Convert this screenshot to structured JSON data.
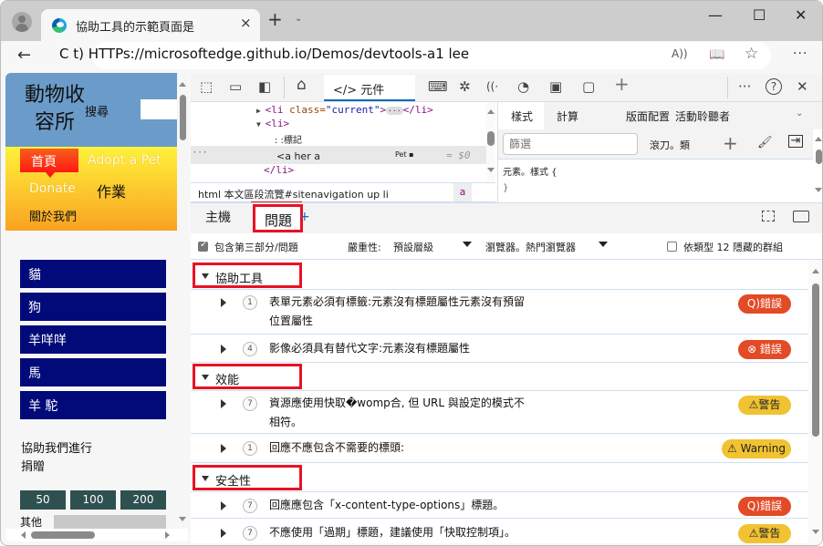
{
  "browser": {
    "tab_title": "協助工具的示範頁面是",
    "tab_close": "×",
    "new_tab": "+",
    "tab_menu": "⌄",
    "window_controls": {
      "minimize": "—",
      "maximize": "☐",
      "close": "✕"
    },
    "back": "←",
    "url": "C t) HTTPs://microsoftedge.github.io/Demos/devtools-a1 lee",
    "read_aloud_icon": "A))",
    "immersive_reader_icon": "📖",
    "favorite_icon": "☆",
    "more": "···"
  },
  "page": {
    "logo": "動物收容所",
    "search_label": "搜尋",
    "nav": {
      "home": "首頁",
      "adopt": "Adopt a Pet",
      "donate": "Donate",
      "jobs": "作業",
      "about": "關於我們"
    },
    "animals": [
      "貓",
      "狗",
      "羊咩咩",
      "馬",
      "羊 駝"
    ],
    "help_text": "協助我們進行捐贈",
    "amounts": [
      "50",
      "100",
      "200"
    ],
    "other_label": "其他"
  },
  "devtools": {
    "toolbar": {
      "inspect_icon": "⬚",
      "device_icon": "▭",
      "dock_icon": "◧",
      "welcome_icon": "⌂",
      "elements_tab": "</> 元件",
      "console_icon": "⌨",
      "sources_icon": "✲",
      "network_icon": "((·",
      "performance_icon": "◔",
      "memory_icon": "▣",
      "application_icon": "▢",
      "add_tool": "+",
      "more": "···",
      "help": "?",
      "close": "✕"
    },
    "dom": {
      "line1_tag_open": "<li ",
      "line1_attr": "class=",
      "line1_val": "\"current\"",
      "line1_close": ">",
      "line1_ellipsis": "···",
      "line1_end": "</li>",
      "line2": "<li>",
      "line3": ": :標記",
      "line4_dots": "···",
      "line4": "<a her a",
      "line4_mid": "Pet ▪",
      "line4_eq": "= $0",
      "line5": "</li>"
    },
    "breadcrumb": "html 本文區段流覽#sitenavigation up li",
    "breadcrumb_end": "a",
    "styles": {
      "tabs": [
        "樣式",
        "計算",
        "版面配置",
        "活動聆聽者"
      ],
      "filter_placeholder": "篩選",
      "hov_cls": "滾刀。類",
      "new_rule": "+",
      "paint_icon": "🖌",
      "sidebar_icon": "⇥",
      "rule_selector": "元素。樣式 {",
      "rule_close": "}"
    },
    "drawer": {
      "tab_host": "主機",
      "tab_issues": "問題",
      "tab_add": "+",
      "include_third_party": "包含第三部分/問題",
      "include_third_party_checked": true,
      "severity_label": "嚴重性:",
      "severity_value": "預設層級",
      "browser_label": "瀏覽器。熱門瀏覽器",
      "group_by_kind": "依類型 12 隱藏的群組",
      "group_by_kind_checked": false,
      "groups": [
        {
          "label": "協助工具",
          "issues": [
            {
              "count": "1",
              "text": "表單元素必須有標籤:元素沒有標題屬性元素沒有預留位置屬性",
              "badge": "Q)錯誤",
              "severity": "error"
            },
            {
              "count": "4",
              "text": "影像必須具有替代文字:元素沒有標題屬性",
              "badge": "⊗ 錯誤",
              "severity": "error"
            }
          ]
        },
        {
          "label": "效能",
          "issues": [
            {
              "count": "7",
              "text": "資源應使用快取�womp合, 但 URL 與設定的模式不相符。",
              "badge": "⚠警告",
              "severity": "warning"
            },
            {
              "count": "1",
              "text": "回應不應包含不需要的標頭:",
              "badge": "⚠ Warning",
              "severity": "warning"
            }
          ]
        },
        {
          "label": "安全性",
          "issues": [
            {
              "count": "7",
              "text": "回應應包含「x-content-type-options」標題。",
              "badge": "Q)錯誤",
              "severity": "error"
            },
            {
              "count": "7",
              "text": "不應使用「過期」標題，建議使用「快取控制項」。",
              "badge": "⚠警告",
              "severity": "warning"
            }
          ]
        }
      ]
    }
  }
}
